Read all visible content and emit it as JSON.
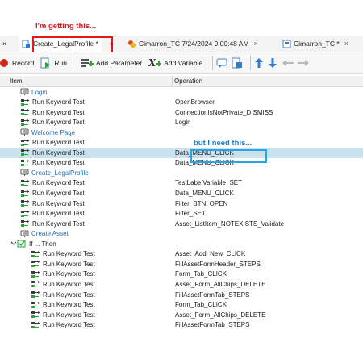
{
  "annotations": {
    "top_note": "I'm getting this...",
    "mid_note": "but I need this..."
  },
  "tabs": [
    {
      "label": "×",
      "close": ""
    },
    {
      "label": "Create_LegalProfile *",
      "close": "×"
    },
    {
      "label": "Cimarron_TC 7/24/2024 9:00:48 AM",
      "close": "×"
    },
    {
      "label": "Cimarron_TC *",
      "close": "×"
    }
  ],
  "toolbar": {
    "record": "Record",
    "run": "Run",
    "add_parameter": "Add Parameter",
    "add_variable": "Add Variable"
  },
  "columns": {
    "item": "Item",
    "operation": "Operation"
  },
  "rows": [
    {
      "type": "group",
      "label": "Login",
      "op": "",
      "indent": 25
    },
    {
      "type": "kw",
      "label": "Run Keyword Test",
      "op": "OpenBrowser",
      "indent": 25
    },
    {
      "type": "kw",
      "label": "Run Keyword Test",
      "op": "ConnectionIsNotPrivate_DISMISS",
      "indent": 25
    },
    {
      "type": "kw",
      "label": "Run Keyword Test",
      "op": "Login",
      "indent": 25
    },
    {
      "type": "group",
      "label": "Welcome Page",
      "op": "",
      "indent": 25
    },
    {
      "type": "kw",
      "label": "Run Keyword Test",
      "op": "",
      "indent": 25
    },
    {
      "type": "kw",
      "label": "Run Keyword Test",
      "op": "Data_MENU_CLICK",
      "indent": 25,
      "selected": true
    },
    {
      "type": "kw",
      "label": "Run Keyword Test",
      "op": "Data_MENU_CLICK",
      "indent": 25
    },
    {
      "type": "group",
      "label": "Create_LegalProfile",
      "op": "",
      "indent": 25
    },
    {
      "type": "kw",
      "label": "Run Keyword Test",
      "op": "TestLabelVariable_SET",
      "indent": 25
    },
    {
      "type": "kw",
      "label": "Run Keyword Test",
      "op": "Data_MENU_CLICK",
      "indent": 25
    },
    {
      "type": "kw",
      "label": "Run Keyword Test",
      "op": "Filter_BTN_OPEN",
      "indent": 25
    },
    {
      "type": "kw",
      "label": "Run Keyword Test",
      "op": "Filter_SET",
      "indent": 25
    },
    {
      "type": "kw",
      "label": "Run Keyword Test",
      "op": "Asset_ListItem_NOTEXISTS_Validate",
      "indent": 25
    },
    {
      "type": "group",
      "label": "Create Asset",
      "op": "",
      "indent": 25
    },
    {
      "type": "if",
      "label": "If ... Then",
      "op": "",
      "indent": 13
    },
    {
      "type": "kw",
      "label": "Run Keyword Test",
      "op": "Asset_Add_New_CLICK",
      "indent": 38
    },
    {
      "type": "kw",
      "label": "Run Keyword Test",
      "op": "FillAssetFormHeader_STEPS",
      "indent": 38
    },
    {
      "type": "kw",
      "label": "Run Keyword Test",
      "op": "Form_Tab_CLICK",
      "indent": 38
    },
    {
      "type": "kw",
      "label": "Run Keyword Test",
      "op": "Asset_Form_AllChips_DELETE",
      "indent": 38
    },
    {
      "type": "kw",
      "label": "Run Keyword Test",
      "op": "FillAssetFormTab_STEPS",
      "indent": 38
    },
    {
      "type": "kw",
      "label": "Run Keyword Test",
      "op": "Form_Tab_CLICK",
      "indent": 38
    },
    {
      "type": "kw",
      "label": "Run Keyword Test",
      "op": "Asset_Form_AllChips_DELETE",
      "indent": 38
    },
    {
      "type": "kw",
      "label": "Run Keyword Test",
      "op": "FillAssetFormTab_STEPS",
      "indent": 38
    }
  ]
}
